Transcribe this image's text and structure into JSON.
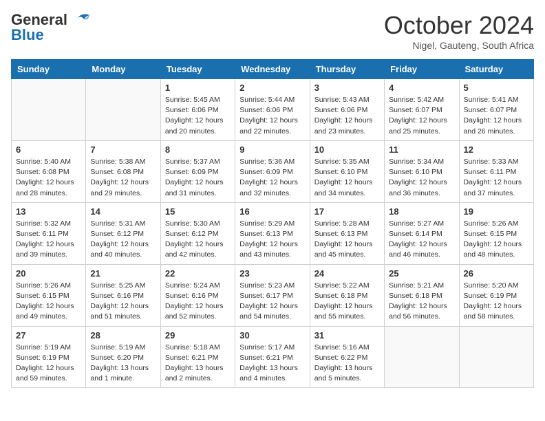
{
  "header": {
    "logo_general": "General",
    "logo_blue": "Blue",
    "month_title": "October 2024",
    "location": "Nigel, Gauteng, South Africa"
  },
  "weekdays": [
    "Sunday",
    "Monday",
    "Tuesday",
    "Wednesday",
    "Thursday",
    "Friday",
    "Saturday"
  ],
  "weeks": [
    [
      {
        "day": "",
        "info": ""
      },
      {
        "day": "",
        "info": ""
      },
      {
        "day": "1",
        "info": "Sunrise: 5:45 AM\nSunset: 6:06 PM\nDaylight: 12 hours and 20 minutes."
      },
      {
        "day": "2",
        "info": "Sunrise: 5:44 AM\nSunset: 6:06 PM\nDaylight: 12 hours and 22 minutes."
      },
      {
        "day": "3",
        "info": "Sunrise: 5:43 AM\nSunset: 6:06 PM\nDaylight: 12 hours and 23 minutes."
      },
      {
        "day": "4",
        "info": "Sunrise: 5:42 AM\nSunset: 6:07 PM\nDaylight: 12 hours and 25 minutes."
      },
      {
        "day": "5",
        "info": "Sunrise: 5:41 AM\nSunset: 6:07 PM\nDaylight: 12 hours and 26 minutes."
      }
    ],
    [
      {
        "day": "6",
        "info": "Sunrise: 5:40 AM\nSunset: 6:08 PM\nDaylight: 12 hours and 28 minutes."
      },
      {
        "day": "7",
        "info": "Sunrise: 5:38 AM\nSunset: 6:08 PM\nDaylight: 12 hours and 29 minutes."
      },
      {
        "day": "8",
        "info": "Sunrise: 5:37 AM\nSunset: 6:09 PM\nDaylight: 12 hours and 31 minutes."
      },
      {
        "day": "9",
        "info": "Sunrise: 5:36 AM\nSunset: 6:09 PM\nDaylight: 12 hours and 32 minutes."
      },
      {
        "day": "10",
        "info": "Sunrise: 5:35 AM\nSunset: 6:10 PM\nDaylight: 12 hours and 34 minutes."
      },
      {
        "day": "11",
        "info": "Sunrise: 5:34 AM\nSunset: 6:10 PM\nDaylight: 12 hours and 36 minutes."
      },
      {
        "day": "12",
        "info": "Sunrise: 5:33 AM\nSunset: 6:11 PM\nDaylight: 12 hours and 37 minutes."
      }
    ],
    [
      {
        "day": "13",
        "info": "Sunrise: 5:32 AM\nSunset: 6:11 PM\nDaylight: 12 hours and 39 minutes."
      },
      {
        "day": "14",
        "info": "Sunrise: 5:31 AM\nSunset: 6:12 PM\nDaylight: 12 hours and 40 minutes."
      },
      {
        "day": "15",
        "info": "Sunrise: 5:30 AM\nSunset: 6:12 PM\nDaylight: 12 hours and 42 minutes."
      },
      {
        "day": "16",
        "info": "Sunrise: 5:29 AM\nSunset: 6:13 PM\nDaylight: 12 hours and 43 minutes."
      },
      {
        "day": "17",
        "info": "Sunrise: 5:28 AM\nSunset: 6:13 PM\nDaylight: 12 hours and 45 minutes."
      },
      {
        "day": "18",
        "info": "Sunrise: 5:27 AM\nSunset: 6:14 PM\nDaylight: 12 hours and 46 minutes."
      },
      {
        "day": "19",
        "info": "Sunrise: 5:26 AM\nSunset: 6:15 PM\nDaylight: 12 hours and 48 minutes."
      }
    ],
    [
      {
        "day": "20",
        "info": "Sunrise: 5:26 AM\nSunset: 6:15 PM\nDaylight: 12 hours and 49 minutes."
      },
      {
        "day": "21",
        "info": "Sunrise: 5:25 AM\nSunset: 6:16 PM\nDaylight: 12 hours and 51 minutes."
      },
      {
        "day": "22",
        "info": "Sunrise: 5:24 AM\nSunset: 6:16 PM\nDaylight: 12 hours and 52 minutes."
      },
      {
        "day": "23",
        "info": "Sunrise: 5:23 AM\nSunset: 6:17 PM\nDaylight: 12 hours and 54 minutes."
      },
      {
        "day": "24",
        "info": "Sunrise: 5:22 AM\nSunset: 6:18 PM\nDaylight: 12 hours and 55 minutes."
      },
      {
        "day": "25",
        "info": "Sunrise: 5:21 AM\nSunset: 6:18 PM\nDaylight: 12 hours and 56 minutes."
      },
      {
        "day": "26",
        "info": "Sunrise: 5:20 AM\nSunset: 6:19 PM\nDaylight: 12 hours and 58 minutes."
      }
    ],
    [
      {
        "day": "27",
        "info": "Sunrise: 5:19 AM\nSunset: 6:19 PM\nDaylight: 12 hours and 59 minutes."
      },
      {
        "day": "28",
        "info": "Sunrise: 5:19 AM\nSunset: 6:20 PM\nDaylight: 13 hours and 1 minute."
      },
      {
        "day": "29",
        "info": "Sunrise: 5:18 AM\nSunset: 6:21 PM\nDaylight: 13 hours and 2 minutes."
      },
      {
        "day": "30",
        "info": "Sunrise: 5:17 AM\nSunset: 6:21 PM\nDaylight: 13 hours and 4 minutes."
      },
      {
        "day": "31",
        "info": "Sunrise: 5:16 AM\nSunset: 6:22 PM\nDaylight: 13 hours and 5 minutes."
      },
      {
        "day": "",
        "info": ""
      },
      {
        "day": "",
        "info": ""
      }
    ]
  ]
}
